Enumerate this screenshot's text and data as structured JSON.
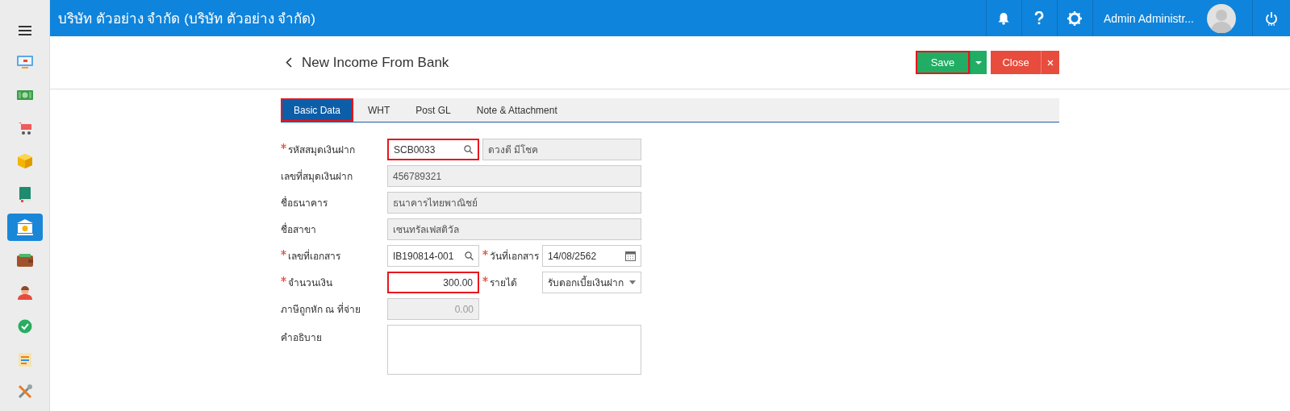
{
  "header": {
    "company": "บริษัท ตัวอย่าง จำกัด (บริษัท ตัวอย่าง จำกัด)",
    "user": "Admin Administr..."
  },
  "sidebar": {
    "items": [
      {
        "kind": "monitor",
        "selected": false
      },
      {
        "kind": "money",
        "selected": false
      },
      {
        "kind": "cart",
        "selected": false
      },
      {
        "kind": "box",
        "selected": false
      },
      {
        "kind": "book",
        "selected": false
      },
      {
        "kind": "bank",
        "selected": true
      },
      {
        "kind": "wallet",
        "selected": false
      },
      {
        "kind": "people",
        "selected": false
      },
      {
        "kind": "check",
        "selected": false
      },
      {
        "kind": "document",
        "selected": false
      },
      {
        "kind": "tools",
        "selected": false
      }
    ]
  },
  "page": {
    "title": "New Income From Bank",
    "buttons": [
      {
        "kind": "save",
        "label": "Save",
        "highlighted": true
      },
      {
        "kind": "close",
        "label": "Close",
        "highlighted": false
      }
    ]
  },
  "tabs": [
    {
      "label": "Basic Data",
      "selected": true,
      "highlighted": true
    },
    {
      "label": "WHT",
      "selected": false,
      "highlighted": false
    },
    {
      "label": "Post GL",
      "selected": false,
      "highlighted": false
    },
    {
      "label": "Note & Attachment",
      "selected": false,
      "highlighted": false
    }
  ],
  "form": {
    "rows": [
      {
        "label": "รหัสสมุดเงินฝาก",
        "required": true,
        "controls": [
          {
            "kind": "lookup",
            "value": "SCB0033",
            "highlighted": true
          },
          {
            "kind": "readonly",
            "value": "ดวงดี มีโชค",
            "highlighted": false
          }
        ]
      },
      {
        "label": "เลขที่สมุดเงินฝาก",
        "required": false,
        "controls": [
          {
            "kind": "readonly",
            "value": "456789321",
            "highlighted": false
          }
        ]
      },
      {
        "label": "ชื่อธนาคาร",
        "required": false,
        "controls": [
          {
            "kind": "readonly",
            "value": "ธนาคารไทยพาณิชย์",
            "highlighted": false
          }
        ]
      },
      {
        "label": "ชื่อสาขา",
        "required": false,
        "controls": [
          {
            "kind": "readonly",
            "value": "เซนทรัลเฟสติวัล",
            "highlighted": false
          }
        ]
      },
      {
        "label": "เลขที่เอกสาร",
        "required": true,
        "controls": [
          {
            "kind": "lookup",
            "value": "IB190814-001",
            "highlighted": false
          },
          {
            "kind": "date",
            "label": "วันที่เอกสาร",
            "required": true,
            "value": "14/08/2562",
            "highlighted": false
          }
        ]
      },
      {
        "label": "จำนวนเงิน",
        "required": true,
        "controls": [
          {
            "kind": "amount",
            "value": "300.00",
            "highlighted": true
          },
          {
            "kind": "select",
            "label": "รายได้",
            "required": true,
            "value": "รับดอกเบี้ยเงินฝาก",
            "highlighted": false
          }
        ]
      },
      {
        "label": "ภาษีถูกหัก ณ ที่จ่าย",
        "required": false,
        "controls": [
          {
            "kind": "readonly-amount",
            "value": "0.00",
            "highlighted": false
          }
        ]
      },
      {
        "label": "คำอธิบาย",
        "required": false,
        "controls": [
          {
            "kind": "textarea",
            "highlighted": false
          }
        ]
      }
    ]
  }
}
